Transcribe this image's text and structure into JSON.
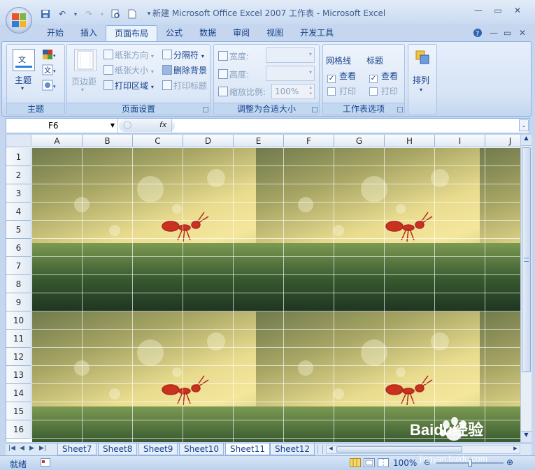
{
  "window": {
    "title": "新建 Microsoft Office Excel 2007 工作表 - Microsoft Excel"
  },
  "qat": {
    "save_icon": "save-icon",
    "undo_icon": "undo-icon",
    "redo_icon": "redo-icon",
    "preview_icon": "print-preview-icon",
    "new_icon": "new-document-icon"
  },
  "tabs": [
    {
      "label": "开始"
    },
    {
      "label": "插入"
    },
    {
      "label": "页面布局"
    },
    {
      "label": "公式"
    },
    {
      "label": "数据"
    },
    {
      "label": "审阅"
    },
    {
      "label": "视图"
    },
    {
      "label": "开发工具"
    }
  ],
  "active_tab": "页面布局",
  "ribbon": {
    "theme": {
      "label": "主题",
      "group_label": "主题",
      "big_label": "主题"
    },
    "page_setup": {
      "group_label": "页面设置",
      "margins": "页边距",
      "orientation": "纸张方向",
      "size": "纸张大小",
      "print_area": "打印区域",
      "breaks": "分隔符",
      "background": "删除背景",
      "print_titles": "打印标题"
    },
    "scale": {
      "group_label": "调整为合适大小",
      "width": "宽度:",
      "height": "高度:",
      "scale": "缩放比例:",
      "scale_value": "100%"
    },
    "sheet_options": {
      "group_label": "工作表选项",
      "gridlines": "网格线",
      "headings": "标题",
      "view": "查看",
      "print": "打印"
    },
    "arrange": {
      "label": "排列"
    }
  },
  "formula_bar": {
    "name_box": "F6",
    "fx_label": "fx",
    "value": ""
  },
  "columns": [
    "A",
    "B",
    "C",
    "D",
    "E",
    "F",
    "G",
    "H",
    "I",
    "J"
  ],
  "rows": [
    "1",
    "2",
    "3",
    "4",
    "5",
    "6",
    "7",
    "8",
    "9",
    "10",
    "11",
    "12",
    "13",
    "14",
    "15",
    "16"
  ],
  "sheets": [
    "Sheet7",
    "Sheet8",
    "Sheet9",
    "Sheet10",
    "Sheet11",
    "Sheet12"
  ],
  "active_sheet": "Sheet11",
  "status": {
    "ready": "就绪",
    "zoom": "100%"
  },
  "watermark": {
    "brand": "Baidu经验",
    "url": "jingyan.baidu.com"
  }
}
